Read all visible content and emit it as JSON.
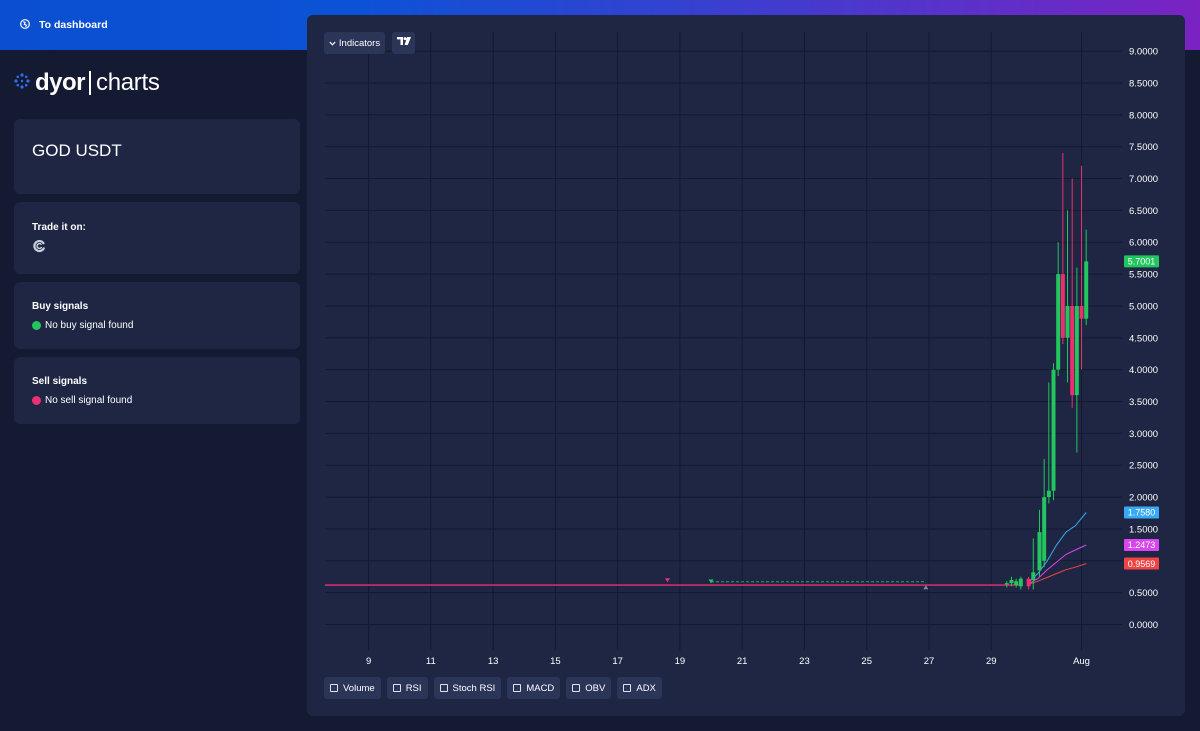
{
  "header": {
    "back_label": "To dashboard",
    "back_icon": "globe-icon"
  },
  "logo": {
    "word1": "dyor",
    "word2": "charts"
  },
  "pair": {
    "title": "GOD USDT"
  },
  "trade": {
    "label": "Trade it on:",
    "exchange_icon": "exchange-logo-icon"
  },
  "buy_signals": {
    "label": "Buy signals",
    "text": "No buy signal found",
    "color": "#22c55e"
  },
  "sell_signals": {
    "label": "Sell signals",
    "text": "No sell signal found",
    "color": "#ec2f71"
  },
  "toolbar": {
    "indicators_label": "Indicators",
    "tradingview_icon": "tradingview-icon"
  },
  "indicator_toggles": [
    {
      "label": "Volume",
      "checked": false
    },
    {
      "label": "RSI",
      "checked": false
    },
    {
      "label": "Stoch RSI",
      "checked": false
    },
    {
      "label": "MACD",
      "checked": false
    },
    {
      "label": "OBV",
      "checked": false
    },
    {
      "label": "ADX",
      "checked": false
    }
  ],
  "colors": {
    "up": "#22c55e",
    "down": "#ec2f71",
    "ma_fast": "#38a9f4",
    "ma_mid": "#d946ef",
    "ma_slow": "#ef4444",
    "grid": "#131a2f"
  },
  "chart_data": {
    "type": "candlestick",
    "y_ticks": [
      "9.0000",
      "8.5000",
      "8.0000",
      "7.5000",
      "7.0000",
      "6.5000",
      "6.0000",
      "5.5000",
      "5.0000",
      "4.5000",
      "4.0000",
      "3.5000",
      "3.0000",
      "2.5000",
      "2.0000",
      "1.5000",
      "1.0000",
      "0.5000",
      "0.0000"
    ],
    "ylim": [
      -0.4,
      9.3
    ],
    "x_ticks": [
      {
        "label": "9",
        "x": 9
      },
      {
        "label": "11",
        "x": 11
      },
      {
        "label": "13",
        "x": 13
      },
      {
        "label": "15",
        "x": 15
      },
      {
        "label": "17",
        "x": 17
      },
      {
        "label": "19",
        "x": 19
      },
      {
        "label": "21",
        "x": 21
      },
      {
        "label": "23",
        "x": 23
      },
      {
        "label": "25",
        "x": 25
      },
      {
        "label": "27",
        "x": 27
      },
      {
        "label": "29",
        "x": 29
      },
      {
        "label": "Aug",
        "x": 31.9
      }
    ],
    "xlim": [
      7.6,
      33.2
    ],
    "price_tags": [
      {
        "value": 5.7001,
        "label": "5.7001",
        "color": "#22c55e"
      },
      {
        "value": 1.758,
        "label": "1.7580",
        "color": "#38a9f4"
      },
      {
        "value": 1.2473,
        "label": "1.2473",
        "color": "#d946ef"
      },
      {
        "value": 0.9569,
        "label": "0.9569",
        "color": "#ef4444"
      }
    ],
    "flat_price": 0.62,
    "candles": [
      {
        "x": 29.5,
        "o": 0.63,
        "h": 0.68,
        "l": 0.58,
        "c": 0.65
      },
      {
        "x": 29.65,
        "o": 0.65,
        "h": 0.75,
        "l": 0.6,
        "c": 0.7
      },
      {
        "x": 29.8,
        "o": 0.62,
        "h": 0.72,
        "l": 0.58,
        "c": 0.68
      },
      {
        "x": 29.95,
        "o": 0.6,
        "h": 0.75,
        "l": 0.55,
        "c": 0.72
      },
      {
        "x": 30.2,
        "o": 0.72,
        "h": 0.75,
        "l": 0.55,
        "c": 0.6
      },
      {
        "x": 30.35,
        "o": 0.7,
        "h": 1.35,
        "l": 0.55,
        "c": 0.82
      },
      {
        "x": 30.55,
        "o": 0.85,
        "h": 1.8,
        "l": 0.75,
        "c": 1.45
      },
      {
        "x": 30.7,
        "o": 1.0,
        "h": 2.6,
        "l": 0.9,
        "c": 2.0
      },
      {
        "x": 30.85,
        "o": 2.0,
        "h": 3.8,
        "l": 1.9,
        "c": 2.1
      },
      {
        "x": 31.0,
        "o": 2.1,
        "h": 4.1,
        "l": 1.95,
        "c": 4.0
      },
      {
        "x": 31.15,
        "o": 4.0,
        "h": 6.0,
        "l": 3.9,
        "c": 5.5
      },
      {
        "x": 31.3,
        "o": 5.5,
        "h": 7.4,
        "l": 4.4,
        "c": 4.5
      },
      {
        "x": 31.45,
        "o": 4.5,
        "h": 6.5,
        "l": 3.8,
        "c": 5.0
      },
      {
        "x": 31.6,
        "o": 5.0,
        "h": 7.0,
        "l": 3.4,
        "c": 3.6
      },
      {
        "x": 31.75,
        "o": 3.6,
        "h": 5.6,
        "l": 2.7,
        "c": 5.0
      },
      {
        "x": 31.9,
        "o": 5.0,
        "h": 7.2,
        "l": 4.0,
        "c": 4.8
      },
      {
        "x": 32.05,
        "o": 4.8,
        "h": 6.2,
        "l": 4.7,
        "c": 5.7
      }
    ],
    "ma_fast": [
      [
        30.2,
        0.66
      ],
      [
        30.5,
        0.8
      ],
      [
        30.8,
        1.0
      ],
      [
        31.1,
        1.25
      ],
      [
        31.4,
        1.45
      ],
      [
        31.7,
        1.55
      ],
      [
        32.05,
        1.758
      ]
    ],
    "ma_mid": [
      [
        30.2,
        0.64
      ],
      [
        30.5,
        0.72
      ],
      [
        30.8,
        0.86
      ],
      [
        31.1,
        0.98
      ],
      [
        31.4,
        1.1
      ],
      [
        31.7,
        1.17
      ],
      [
        32.05,
        1.2473
      ]
    ],
    "ma_slow": [
      [
        30.2,
        0.63
      ],
      [
        30.5,
        0.68
      ],
      [
        30.8,
        0.74
      ],
      [
        31.1,
        0.8
      ],
      [
        31.4,
        0.86
      ],
      [
        31.7,
        0.9
      ],
      [
        32.05,
        0.9569
      ]
    ],
    "markers": [
      {
        "x": 18.6,
        "y": 0.68,
        "shape": "down",
        "color": "#ec2f71"
      },
      {
        "x": 20.0,
        "y": 0.66,
        "shape": "down",
        "color": "#22c55e"
      },
      {
        "x": 26.9,
        "y": 0.6,
        "shape": "up",
        "color": "#7e8aa6"
      }
    ],
    "dashed_segment": {
      "x1": 20.0,
      "x2": 26.9,
      "y": 0.67,
      "color": "#22c55e"
    }
  }
}
